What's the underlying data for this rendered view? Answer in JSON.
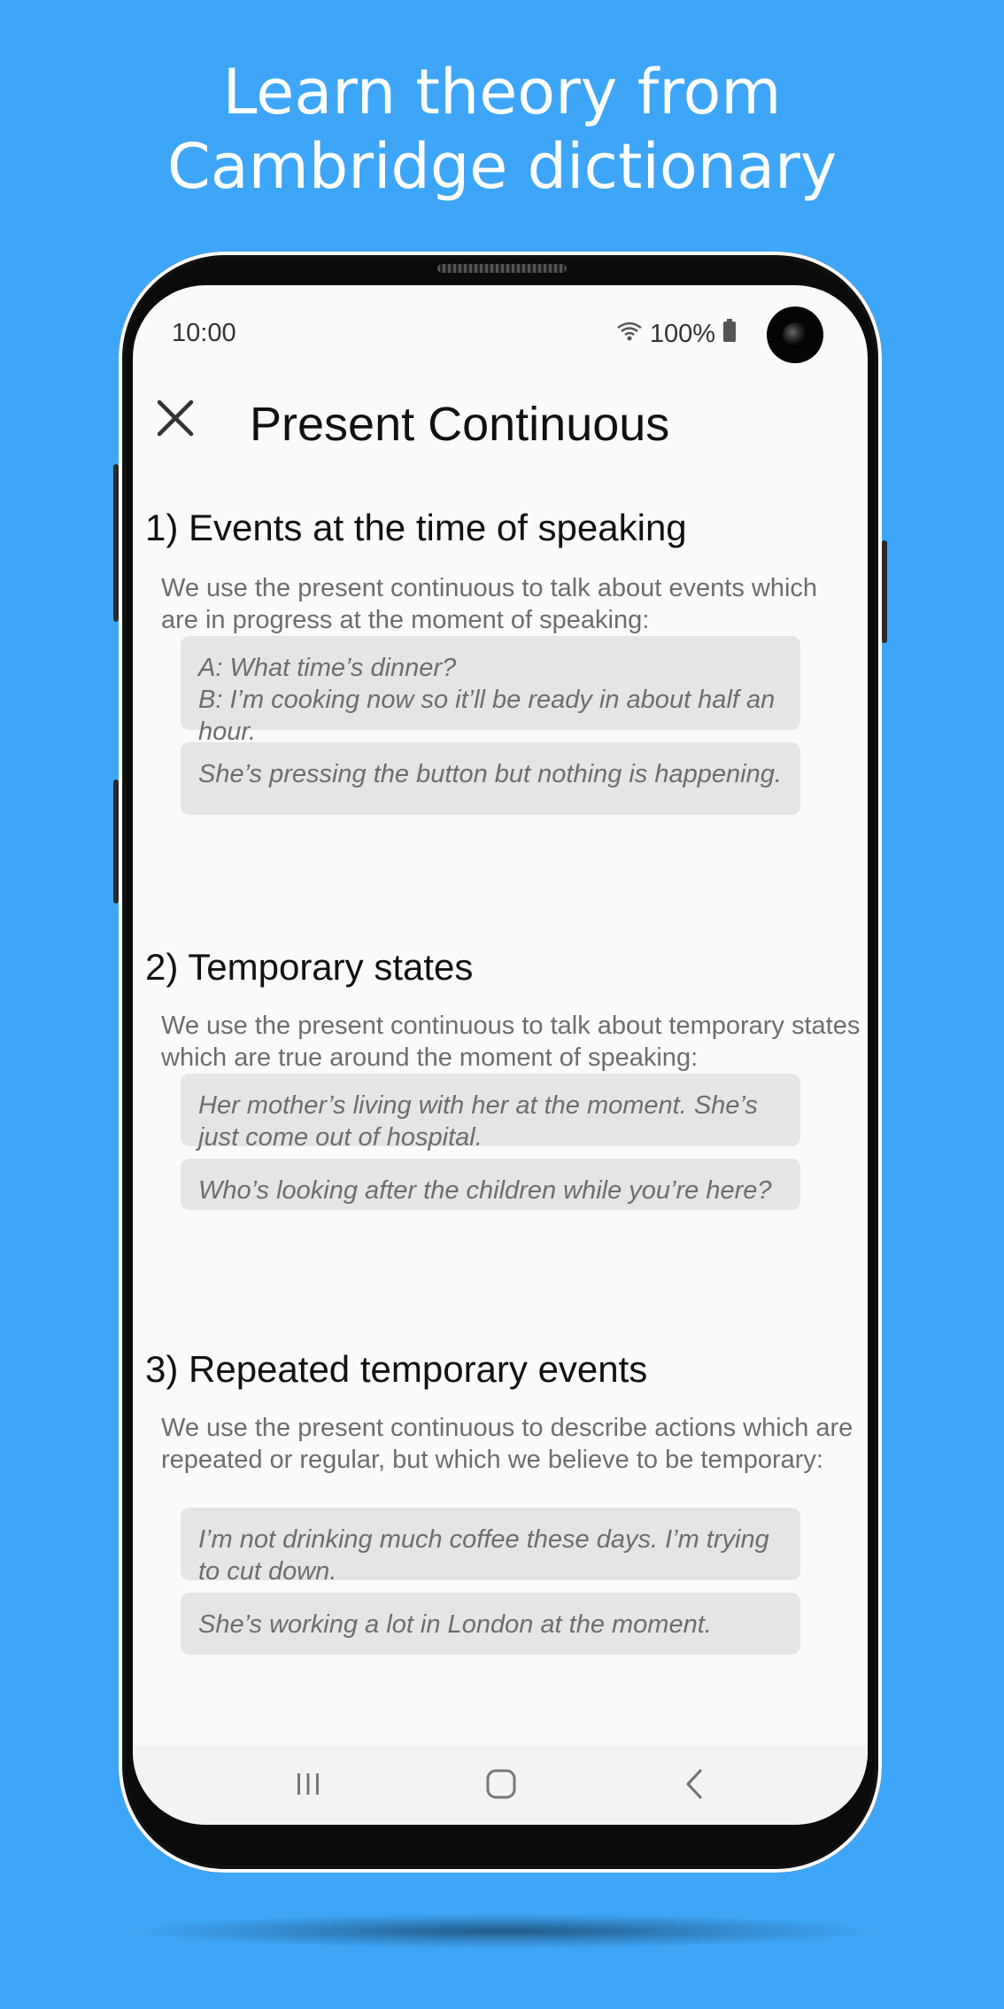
{
  "promo": {
    "line1": "Learn theory from",
    "line2": "Cambridge dictionary"
  },
  "status_bar": {
    "time": "10:00",
    "battery": "100%"
  },
  "app_bar": {
    "title": "Present Continuous",
    "close_icon": "close-icon"
  },
  "sections": [
    {
      "title": "1) Events at the time of speaking",
      "description": "We use the present continuous to talk about events which are in progress at the moment of speaking:",
      "examples": [
        [
          "A: What time’s dinner?",
          "B: I’m cooking now so it’ll be ready in about half an hour."
        ],
        [
          "She’s pressing the button but nothing is happening."
        ]
      ]
    },
    {
      "title": "2) Temporary states",
      "description": "We use the present continuous to talk about temporary states which are true around the moment of speaking:",
      "examples": [
        [
          "Her mother’s living with her at the moment. She’s just come out of hospital."
        ],
        [
          "Who’s looking after the children while you’re here?"
        ]
      ]
    },
    {
      "title": "3) Repeated temporary events",
      "description": "We use the present continuous to describe actions which are repeated or regular, but which we believe to be temporary:",
      "examples": [
        [
          "I’m not drinking much coffee these days. I’m trying to cut down."
        ],
        [
          "She’s working a lot in London at the moment."
        ]
      ]
    }
  ],
  "nav_bar": {
    "recents_icon": "recents-icon",
    "home_icon": "home-icon",
    "back_icon": "back-icon"
  },
  "colors": {
    "background": "#3ea6f8",
    "screen": "#fafafa",
    "example_bg": "#e5e5e5"
  }
}
